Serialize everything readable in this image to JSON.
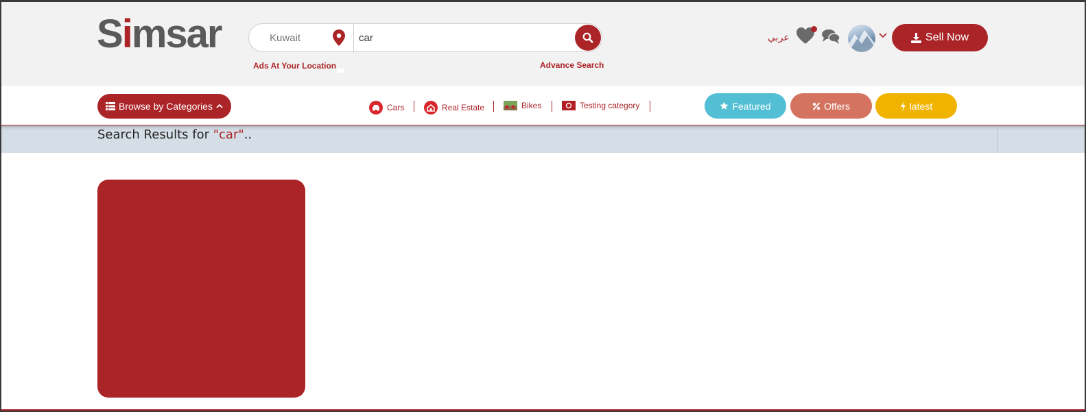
{
  "brand": {
    "logo_part1": "S",
    "logo_part2": "i",
    "logo_part3": "msar",
    "accent_color": "#ab2428"
  },
  "search": {
    "location_placeholder": "Kuwait",
    "query_value": "car",
    "ads_at_location_label": "Ads At Your Location",
    "advance_search_label": "Advance Search"
  },
  "header_actions": {
    "language_label": "عربي",
    "sell_label": "Sell Now"
  },
  "catbar": {
    "browse_label": "Browse by Categories",
    "categories": [
      {
        "label": "Cars",
        "icon": "car-icon"
      },
      {
        "label": "Real Estate",
        "icon": "house-icon"
      },
      {
        "label": "Bikes",
        "icon": "bikes-thumbnail"
      },
      {
        "label": "Testing category",
        "icon": "testing-thumbnail"
      }
    ],
    "pills": {
      "featured": "Featured",
      "offers": "Offers",
      "latest": "latest"
    },
    "pill_colors": {
      "featured": "#52bfd4",
      "offers": "#d4735f",
      "latest": "#f0b400"
    }
  },
  "results": {
    "prefix": "Search Results for ",
    "query": "\"car\"",
    "suffix": ".."
  }
}
